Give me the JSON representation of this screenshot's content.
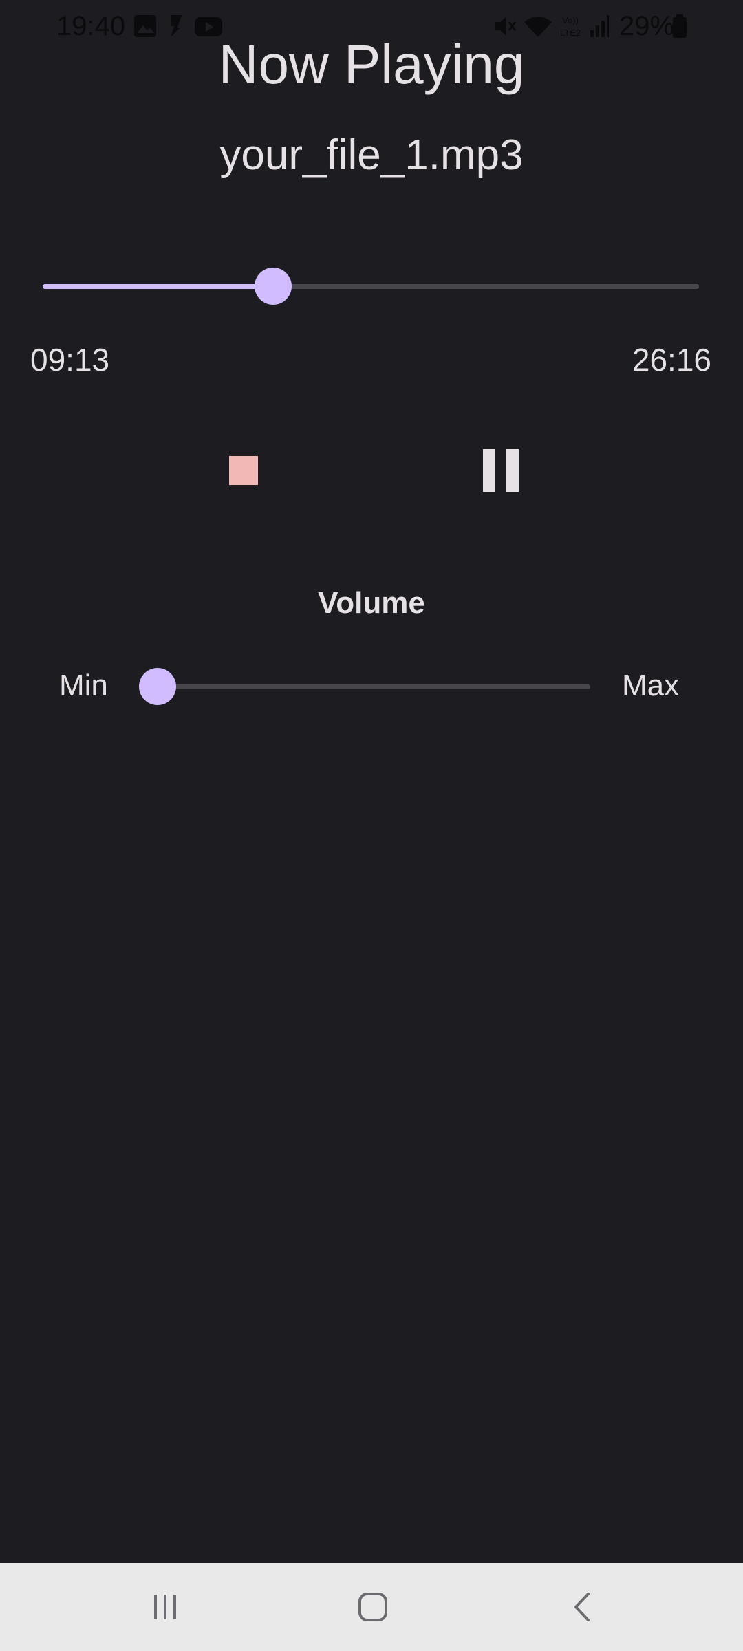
{
  "status_bar": {
    "time": "19:40",
    "battery": "29%",
    "icons": [
      "gallery-icon",
      "message-icon",
      "youtube-icon",
      "mute-icon",
      "wifi-icon",
      "volte-lte2-icon",
      "signal-icon",
      "battery-icon"
    ]
  },
  "player": {
    "title": "Now Playing",
    "file_name": "your_file_1.mp3",
    "elapsed": "09:13",
    "total": "26:16",
    "progress_fraction": 0.351,
    "accent_color": "#d0bcff",
    "stop_color": "#f2b8b5"
  },
  "volume": {
    "heading": "Volume",
    "min_label": "Min",
    "max_label": "Max",
    "level_fraction": 0.03
  },
  "nav_bar": {
    "buttons": [
      "recents-icon",
      "home-icon",
      "back-icon"
    ]
  }
}
